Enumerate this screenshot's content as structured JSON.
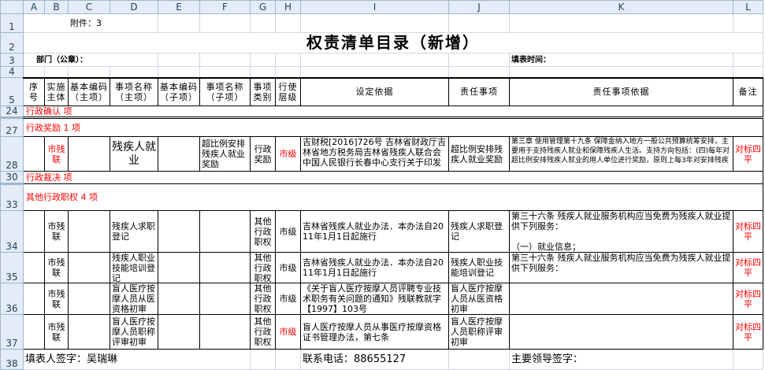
{
  "columns": [
    "A",
    "B",
    "C",
    "D",
    "E",
    "F",
    "G",
    "H",
    "I",
    "J",
    "K",
    "L"
  ],
  "row_numbers": {
    "r1": "1",
    "r2": "2",
    "r3": "3",
    "r4": "4",
    "r5": "5",
    "r24": "24",
    "r27": "27",
    "r28": "28",
    "r30": "30",
    "r33": "33",
    "r34": "34",
    "r35": "35",
    "r36": "36",
    "r37": "37",
    "r38": "38"
  },
  "attachment": "附件：3",
  "title": "权责清单目录（新增）",
  "department_label": "部门（公章）：",
  "fill_time_label": "填表时间：",
  "headers": [
    "序号",
    "实施主体",
    "基本编码（主项）",
    "事项名称（主项）",
    "基本编码（子项）",
    "事项名称（子项）",
    "事项类别",
    "行使层级",
    "设定依据",
    "责任事项",
    "责任事项依据",
    "备注"
  ],
  "sections": {
    "confirm": "行政确认   项",
    "reward": "行政奖励 1 项",
    "ruling": "行政裁决   项",
    "other": "其他行政职权 4 项"
  },
  "reward_rows": [
    {
      "subject": "市残联",
      "main_name": "残疾人就业",
      "sub_name": "超比例安排残疾人就业奖励",
      "category": "行政奖励",
      "level": "市级",
      "basis": "吉财税[2016]726号 吉林省财政厅吉林省地方税务局吉林省残疾人联合会中国人民银行长春中心支行关于印发",
      "duty": "超比例安排残疾人就业奖励",
      "duty_basis": "第三章 使用管理第十九条 保障金纳入地方一般公共预算统筹安排，主要用于支持残疾人就业和保障残疾人生活。支持方向包括：(四)每年对超比例安排残疾人就业的用人单位进行奖励，原则上每3年对安排残疾",
      "note": "对标四平"
    }
  ],
  "other_rows": [
    {
      "subject": "市残联",
      "main_name": "残疾人求职登记",
      "category": "其他行政职权",
      "level": "市级",
      "basis": "吉林省残疾人就业办法．本办法自2011年1月1日起施行",
      "duty": "残疾人求职登记",
      "duty_basis": "第三十六条 残疾人就业服务机构应当免费为残疾人就业提供下列服务：\n\n（一）就业信息；",
      "note": "对标四平"
    },
    {
      "subject": "市残联",
      "main_name": "残疾人职业技能培训登记",
      "category": "其他行政职权",
      "level": "市级",
      "basis": "吉林省残疾人就业办法．本办法自2011年1月1日起施行",
      "duty": "残疾人职业技能培训登记",
      "duty_basis": "第三十六条 残疾人就业服务机构应当免费为残疾人就业提供下列服务：",
      "note": "对标四平"
    },
    {
      "subject": "市残联",
      "main_name": "盲人医疗按摩人员从医资格初审",
      "category": "其他行政职权",
      "level": "市级",
      "basis": "《关于盲人医疗按摩人员评聘专业技术职务有关问题的通知》残联教就字【1997】103号",
      "duty": "盲人医疗按摩人员从医资格初审",
      "duty_basis": "",
      "note": "对标四平"
    },
    {
      "subject": "市残联",
      "main_name": "盲人医疗按摩人员职称评审初审",
      "category": "其他行政职权",
      "level": "市级",
      "basis": "盲人医疗按摩人员从事医疗按摩资格证书管理办法，第七条",
      "duty": "盲人医疗按摩人员职称评审初审",
      "duty_basis": "",
      "note": "对标四平"
    }
  ],
  "footer": {
    "filler": "填表人签字：吴瑞琳",
    "phone": "联系电话：88655127",
    "leader": "主要领导签字："
  },
  "colors": {
    "red": "#ff0000",
    "header_bg": "#e4ecf7",
    "grid": "#d0d7e5"
  }
}
